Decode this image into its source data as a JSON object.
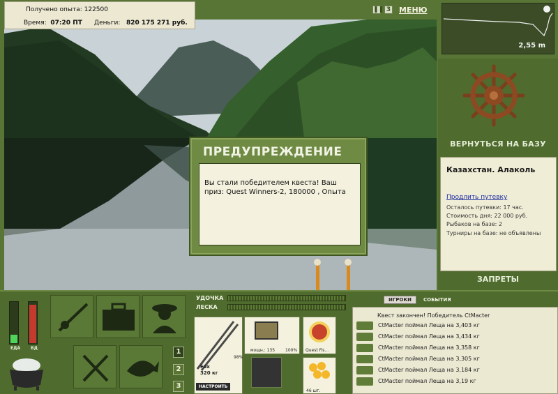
{
  "stats": {
    "experience_label": "Получено опыта:",
    "experience_value": "122500",
    "time_label": "Время:",
    "time_value": "07:20 ПТ",
    "money_label": "Деньги:",
    "money_value": "820 175 271 руб."
  },
  "toolbar": {
    "pause_icon": "pause-icon",
    "sound_label": "3",
    "menu_label": "МЕНЮ"
  },
  "depth": {
    "value": "2,55 m"
  },
  "right_panel": {
    "return_label": "ВЕРНУТЬСЯ НА БАЗУ",
    "location_name": "Казахстан. Алаколь",
    "extend_link": "Продлить путевку",
    "lines": [
      "Осталось путевки: 17 час.",
      "Стоимость дня: 22 000 руб.",
      "Рыбаков на базе: 2",
      "Турниры на базе: не объявлены"
    ],
    "bans_label": "ЗАПРЕТЫ"
  },
  "dialog": {
    "title": "ПРЕДУПРЕЖДЕНИЕ",
    "message": "Вы стали победителем квеста! Ваш приз: Quest Winners-2, 180000 , Опыта"
  },
  "meters": {
    "food_label": "ЕДА",
    "vd_label": "ВД",
    "food_level": 0.2,
    "vd_level": 0.95
  },
  "tabs": [
    "1",
    "2",
    "3"
  ],
  "tackle": {
    "rod_label": "УДОЧКА",
    "line_label": "ЛЕСКА",
    "rod_name": "Fox",
    "rod_weight": "320 кг",
    "rod_condition": "98%",
    "reel_power": "мощн.: 135",
    "reel_condition": "100%",
    "line_name": "Quest Fis...",
    "bait_count": "46 шт.",
    "setup_button": "НАСТРОИТЬ"
  },
  "players": {
    "tab_players": "ИГРОКИ",
    "tab_events": "СОБЫТИЯ",
    "header": "Квест закончен! Победитель CtMacter",
    "catches": [
      "CtMacter поймал Леща на 3,403 кг",
      "CtMacter поймал Леща на 3,434 кг",
      "CtMacter поймал Леща на 3,358 кг",
      "CtMacter поймал Леща на 3,305 кг",
      "CtMacter поймал Леща на 3,184 кг",
      "CtMacter поймал Леща на 3,19 кг"
    ]
  },
  "colors": {
    "panel_green": "#4f6b2e",
    "paper": "#f0edd6",
    "link_blue": "#1a2aa0"
  }
}
